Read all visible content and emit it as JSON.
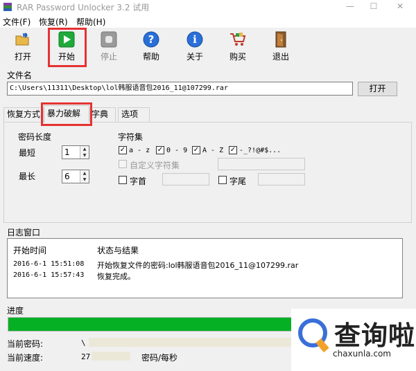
{
  "window": {
    "title": "RAR Password Unlocker 3.2 试用",
    "minimize": "—",
    "maximize": "☐",
    "close": "✕"
  },
  "menu": [
    {
      "label": "文件(F)"
    },
    {
      "label": "恢复(R)"
    },
    {
      "label": "帮助(H)"
    }
  ],
  "toolbar": {
    "open": "打开",
    "start": "开始",
    "stop": "停止",
    "help": "帮助",
    "about": "关于",
    "buy": "购买",
    "exit": "退出"
  },
  "file": {
    "label": "文件名",
    "path": "C:\\Users\\11311\\Desktop\\lol韩服语音包2016_11@107299.rar",
    "open_button": "打开"
  },
  "tabs": [
    {
      "label": "恢复方式"
    },
    {
      "label": "暴力破解"
    },
    {
      "label": "字典"
    },
    {
      "label": "选项"
    }
  ],
  "brute": {
    "length_title": "密码长度",
    "min_label": "最短",
    "min_value": "1",
    "max_label": "最长",
    "max_value": "6",
    "charset_title": "字符集",
    "charsets": [
      {
        "label": "a - z",
        "checked": true
      },
      {
        "label": "0 - 9",
        "checked": true
      },
      {
        "label": "A - Z",
        "checked": true
      },
      {
        "label": "-_?!@#$...",
        "checked": true
      }
    ],
    "custom_label": "自定义字符集",
    "prefix_label": "字首",
    "suffix_label": "字尾"
  },
  "log": {
    "label": "日志窗口",
    "col_time": "开始时间",
    "col_status": "状态与结果",
    "rows": [
      {
        "time": "2016-6-1 15:51:08",
        "status": "开始恢复文件的密码:lol韩服语音包2016_11@107299.rar"
      },
      {
        "time": "2016-6-1 15:57:43",
        "status": "恢复完成。"
      }
    ]
  },
  "progress": {
    "label": "进度",
    "percent": 100,
    "current_password_label": "当前密码:",
    "current_password_value": "\\",
    "current_speed_label": "当前速度:",
    "current_speed_value": "27",
    "speed_unit": "密码/每秒"
  },
  "watermark": {
    "text": "查询啦",
    "sub": "chaxunla.com"
  },
  "colors": {
    "accent_red": "#e53232",
    "progress_green": "#06b025",
    "watermark_blue": "#3a6fd8",
    "watermark_orange": "#f2a22a"
  }
}
